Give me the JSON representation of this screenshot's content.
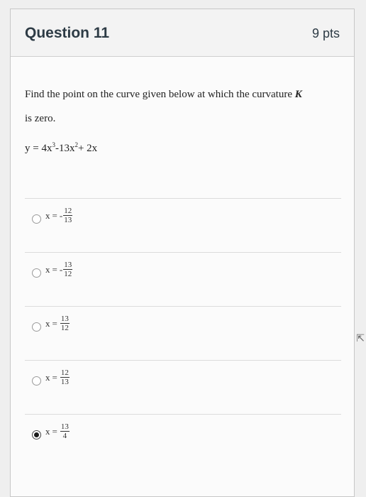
{
  "question": {
    "title": "Question 11",
    "points": "9 pts",
    "prompt_main": "Find the point on the curve given below at which the curvature ",
    "prompt_var": "K",
    "prompt_end": "is zero.",
    "equation": {
      "lhs": "y = 4x",
      "exp1": "3",
      "mid": "-13x",
      "exp2": "2",
      "rhs": "+ 2x"
    }
  },
  "answers": [
    {
      "var": "x",
      "eq": "=",
      "sign": "-",
      "num": "12",
      "den": "13",
      "selected": false
    },
    {
      "var": "x",
      "eq": "=",
      "sign": "-",
      "num": "13",
      "den": "12",
      "selected": false
    },
    {
      "var": "x",
      "eq": "=",
      "sign": "",
      "num": "13",
      "den": "12",
      "selected": false
    },
    {
      "var": "x",
      "eq": "=",
      "sign": "",
      "num": "12",
      "den": "13",
      "selected": false
    },
    {
      "var": "x",
      "eq": "=",
      "sign": "",
      "num": "13",
      "den": "4",
      "selected": true
    }
  ]
}
